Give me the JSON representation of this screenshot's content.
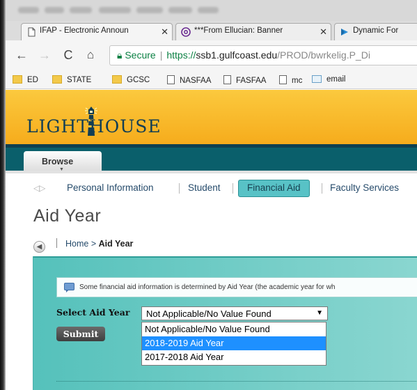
{
  "browser": {
    "tabs": [
      {
        "label": "IFAP - Electronic Announ",
        "icon": "page-icon"
      },
      {
        "label": "***From Ellucian: Banner",
        "icon": "at-sign-icon"
      },
      {
        "label": "Dynamic For",
        "icon": "dynamic-forms-icon"
      }
    ],
    "omnibox": {
      "secure_label": "Secure",
      "protocol": "https://",
      "host": "ssb1.gulfcoast.edu",
      "path": "/PROD/bwrkelig.P_Di"
    },
    "bookmarks": [
      {
        "label": "ED",
        "icon": "folder-icon"
      },
      {
        "label": "STATE",
        "icon": "folder-icon"
      },
      {
        "label": "GCSC",
        "icon": "folder-icon"
      },
      {
        "label": "NASFAA",
        "icon": "page-icon"
      },
      {
        "label": "FASFAA",
        "icon": "page-icon"
      },
      {
        "label": "mc",
        "icon": "page-icon"
      },
      {
        "label": "email",
        "icon": "mail-icon"
      }
    ]
  },
  "site": {
    "logo_text": "LIGHTHOUSE",
    "browse_label": "Browse",
    "nav": [
      "Personal Information",
      "Student",
      "Financial Aid",
      "Faculty Services"
    ],
    "selected_nav": "Financial Aid"
  },
  "page": {
    "title": "Aid Year",
    "breadcrumb": {
      "home": "Home",
      "separator": ">",
      "current": "Aid Year"
    },
    "info_text": "Some financial aid information is determined by Aid Year (the academic year for wh",
    "select_label": "Select Aid Year",
    "select_value": "Not Applicable/No Value Found",
    "options": [
      "Not Applicable/No Value Found",
      "2018-2019 Aid Year",
      "2017-2018 Aid Year"
    ],
    "highlighted_option": "2018-2019 Aid Year",
    "submit_label": "Submit"
  },
  "colors": {
    "banner": "#f8b52a",
    "teal_bar": "#0a5f6b",
    "nav_selected": "#58c2c6",
    "panel": "#6ccbc5",
    "dropdown_highlight": "#1e90ff"
  }
}
